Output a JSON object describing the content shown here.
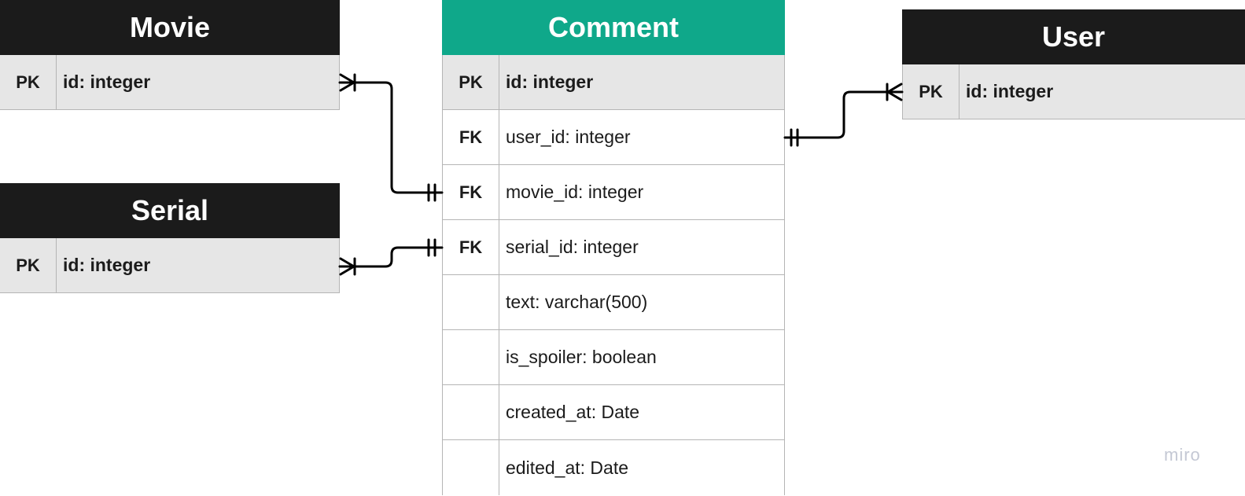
{
  "colors": {
    "dark_header": "#1b1b1b",
    "comment_header": "#0fa88a",
    "pk_row": "#e6e6e6",
    "line": "#000000"
  },
  "entities": {
    "movie": {
      "title": "Movie",
      "rows": [
        {
          "key": "PK",
          "field": "id: integer"
        }
      ]
    },
    "serial": {
      "title": "Serial",
      "rows": [
        {
          "key": "PK",
          "field": "id: integer"
        }
      ]
    },
    "comment": {
      "title": "Comment",
      "rows": [
        {
          "key": "PK",
          "field": "id: integer"
        },
        {
          "key": "FK",
          "field": "user_id: integer"
        },
        {
          "key": "FK",
          "field": "movie_id: integer"
        },
        {
          "key": "FK",
          "field": "serial_id: integer"
        },
        {
          "key": "",
          "field": "text: varchar(500)"
        },
        {
          "key": "",
          "field": "is_spoiler: boolean"
        },
        {
          "key": "",
          "field": "created_at: Date"
        },
        {
          "key": "",
          "field": "edited_at: Date"
        }
      ]
    },
    "user": {
      "title": "User",
      "rows": [
        {
          "key": "PK",
          "field": "id: integer"
        }
      ]
    }
  },
  "relationships": [
    {
      "from": "movie.id",
      "to": "comment.movie_id",
      "from_cardinality": "one-or-many",
      "to_cardinality": "exactly-one"
    },
    {
      "from": "serial.id",
      "to": "comment.serial_id",
      "from_cardinality": "one-or-many",
      "to_cardinality": "exactly-one"
    },
    {
      "from": "user.id",
      "to": "comment.user_id",
      "from_cardinality": "one-or-many",
      "to_cardinality": "exactly-one"
    }
  ],
  "watermark": "miro"
}
